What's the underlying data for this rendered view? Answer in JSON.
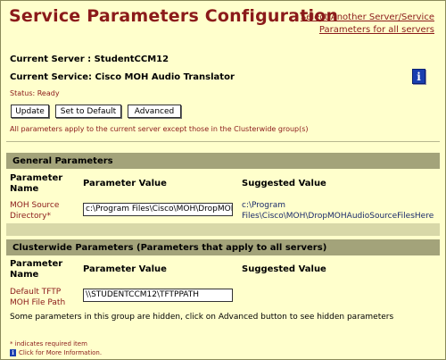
{
  "header": {
    "title": "Service Parameters Configuration",
    "links": [
      "Select Another Server/Service",
      "Parameters for all servers"
    ]
  },
  "server": {
    "label": "Current Server :",
    "value": "StudentCCM12"
  },
  "service": {
    "label": "Current Service:",
    "value": "Cisco MOH Audio Translator"
  },
  "info_icon": "i",
  "status": {
    "label": "Status:",
    "value": "Ready"
  },
  "buttons": {
    "update": "Update",
    "default": "Set to Default",
    "advanced": "Advanced"
  },
  "note": "All parameters apply to the current server except those in the Clusterwide group(s)",
  "columns": {
    "name": "Parameter Name",
    "value": "Parameter Value",
    "suggested": "Suggested Value"
  },
  "general": {
    "title": "General Parameters",
    "params": [
      {
        "name": "MOH Source Directory*",
        "value": "c:\\Program Files\\Cisco\\MOH\\DropMOHA",
        "suggested_line1": "c:\\Program",
        "suggested_line2": "Files\\Cisco\\MOH\\DropMOHAudioSourceFilesHere"
      }
    ]
  },
  "clusterwide": {
    "title": "Clusterwide Parameters (Parameters that apply to all servers)",
    "params": [
      {
        "name": "Default TFTP MOH File Path",
        "value": "\\\\STUDENTCCM12\\TFTPPATH",
        "suggested": ""
      }
    ],
    "hidden_note": "Some parameters in this group are hidden, click on Advanced button to see hidden parameters"
  },
  "footer": {
    "required": "* indicates required item",
    "more_info": "Click for More Information."
  },
  "colors": {
    "title": "#8b1a1a",
    "background": "#ffffcc",
    "section_bar": "#a3a37a",
    "info": "#1a3fb0"
  }
}
